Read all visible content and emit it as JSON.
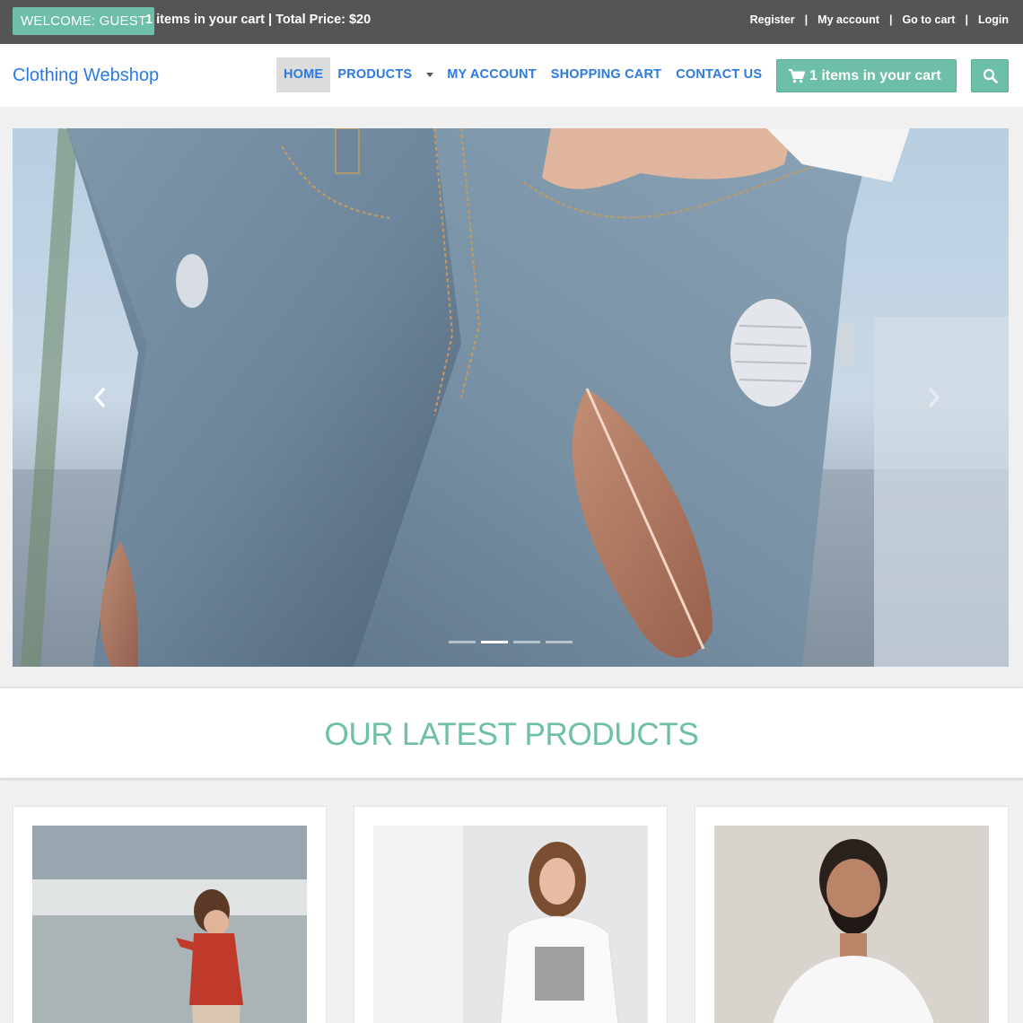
{
  "topbar": {
    "welcome": "WELCOME: GUEST",
    "cart_summary": "1 items in your cart | Total Price: $20",
    "links": [
      "Register",
      "My account",
      "Go to cart",
      "Login"
    ],
    "separator": "|"
  },
  "navbar": {
    "brand": "Clothing Webshop",
    "items": [
      "HOME",
      "PRODUCTS",
      "MY ACCOUNT",
      "SHOPPING CART",
      "CONTACT US"
    ],
    "active": "HOME",
    "cart_button": "1 items in your cart",
    "search_icon": "search-icon"
  },
  "carousel": {
    "slides": 4,
    "active_slide": 2,
    "prev_icon": "chevron-left-icon",
    "next_icon": "chevron-right-icon"
  },
  "section": {
    "title": "OUR LATEST PRODUCTS"
  },
  "colors": {
    "accent": "#6dbfa7",
    "link": "#2a7ae2",
    "topbar": "#555555"
  }
}
